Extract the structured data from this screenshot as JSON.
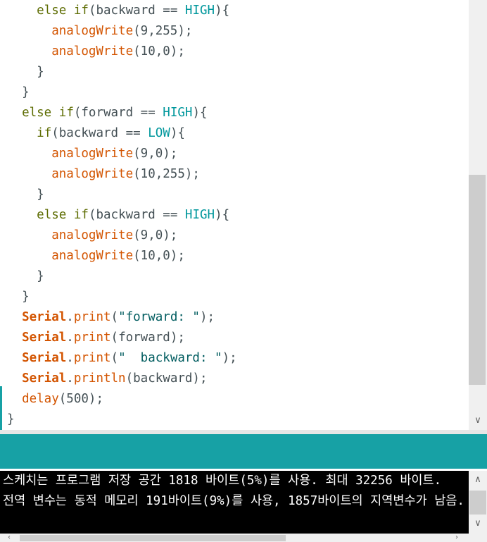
{
  "editor": {
    "lines": [
      {
        "indent": "    ",
        "tokens": [
          {
            "t": "else",
            "c": "kw"
          },
          {
            "t": " ",
            "c": "pn"
          },
          {
            "t": "if",
            "c": "kw"
          },
          {
            "t": "(backward == ",
            "c": "pn"
          },
          {
            "t": "HIGH",
            "c": "cst"
          },
          {
            "t": "){",
            "c": "pn"
          }
        ]
      },
      {
        "indent": "      ",
        "tokens": [
          {
            "t": "analogWrite",
            "c": "fn"
          },
          {
            "t": "(9,255);",
            "c": "pn"
          }
        ]
      },
      {
        "indent": "      ",
        "tokens": [
          {
            "t": "analogWrite",
            "c": "fn"
          },
          {
            "t": "(10,0);",
            "c": "pn"
          }
        ]
      },
      {
        "indent": "    ",
        "tokens": [
          {
            "t": "}",
            "c": "pn"
          }
        ]
      },
      {
        "indent": "  ",
        "tokens": [
          {
            "t": "}",
            "c": "pn"
          }
        ]
      },
      {
        "indent": "  ",
        "tokens": [
          {
            "t": "else",
            "c": "kw"
          },
          {
            "t": " ",
            "c": "pn"
          },
          {
            "t": "if",
            "c": "kw"
          },
          {
            "t": "(forward == ",
            "c": "pn"
          },
          {
            "t": "HIGH",
            "c": "cst"
          },
          {
            "t": "){",
            "c": "pn"
          }
        ]
      },
      {
        "indent": "    ",
        "tokens": [
          {
            "t": "if",
            "c": "kw"
          },
          {
            "t": "(backward == ",
            "c": "pn"
          },
          {
            "t": "LOW",
            "c": "cst"
          },
          {
            "t": "){",
            "c": "pn"
          }
        ]
      },
      {
        "indent": "      ",
        "tokens": [
          {
            "t": "analogWrite",
            "c": "fn"
          },
          {
            "t": "(9,0);",
            "c": "pn"
          }
        ]
      },
      {
        "indent": "      ",
        "tokens": [
          {
            "t": "analogWrite",
            "c": "fn"
          },
          {
            "t": "(10,255);",
            "c": "pn"
          }
        ]
      },
      {
        "indent": "    ",
        "tokens": [
          {
            "t": "}",
            "c": "pn"
          }
        ]
      },
      {
        "indent": "    ",
        "tokens": [
          {
            "t": "else",
            "c": "kw"
          },
          {
            "t": " ",
            "c": "pn"
          },
          {
            "t": "if",
            "c": "kw"
          },
          {
            "t": "(backward == ",
            "c": "pn"
          },
          {
            "t": "HIGH",
            "c": "cst"
          },
          {
            "t": "){",
            "c": "pn"
          }
        ]
      },
      {
        "indent": "      ",
        "tokens": [
          {
            "t": "analogWrite",
            "c": "fn"
          },
          {
            "t": "(9,0);",
            "c": "pn"
          }
        ]
      },
      {
        "indent": "      ",
        "tokens": [
          {
            "t": "analogWrite",
            "c": "fn"
          },
          {
            "t": "(10,0);",
            "c": "pn"
          }
        ]
      },
      {
        "indent": "    ",
        "tokens": [
          {
            "t": "}",
            "c": "pn"
          }
        ]
      },
      {
        "indent": "  ",
        "tokens": [
          {
            "t": "}",
            "c": "pn"
          }
        ]
      },
      {
        "indent": "  ",
        "tokens": [
          {
            "t": "Serial",
            "c": "obj"
          },
          {
            "t": ".",
            "c": "pn"
          },
          {
            "t": "print",
            "c": "fn"
          },
          {
            "t": "(",
            "c": "pn"
          },
          {
            "t": "\"forward: \"",
            "c": "str"
          },
          {
            "t": ");",
            "c": "pn"
          }
        ]
      },
      {
        "indent": "  ",
        "tokens": [
          {
            "t": "Serial",
            "c": "obj"
          },
          {
            "t": ".",
            "c": "pn"
          },
          {
            "t": "print",
            "c": "fn"
          },
          {
            "t": "(forward);",
            "c": "pn"
          }
        ]
      },
      {
        "indent": "  ",
        "tokens": [
          {
            "t": "Serial",
            "c": "obj"
          },
          {
            "t": ".",
            "c": "pn"
          },
          {
            "t": "print",
            "c": "fn"
          },
          {
            "t": "(",
            "c": "pn"
          },
          {
            "t": "\"  backward: \"",
            "c": "str"
          },
          {
            "t": ");",
            "c": "pn"
          }
        ]
      },
      {
        "indent": "  ",
        "tokens": [
          {
            "t": "Serial",
            "c": "obj"
          },
          {
            "t": ".",
            "c": "pn"
          },
          {
            "t": "println",
            "c": "fn"
          },
          {
            "t": "(backward);",
            "c": "pn"
          }
        ]
      },
      {
        "indent": "  ",
        "tokens": [
          {
            "t": "delay",
            "c": "fn"
          },
          {
            "t": "(500);",
            "c": "pn"
          }
        ]
      },
      {
        "indent": "",
        "tokens": [
          {
            "t": "}",
            "c": "pn"
          }
        ]
      }
    ]
  },
  "console": {
    "lines": [
      "스케치는 프로그램 저장 공간 1818 바이트(5%)를 사용. 최대 32256 바이트.",
      "전역 변수는 동적 메모리 191바이트(9%)를 사용, 1857바이트의 지역변수가 남음."
    ]
  },
  "icons": {
    "scroll_down": "chevron-down-icon",
    "scroll_up": "chevron-up-icon",
    "scroll_left": "chevron-left-icon",
    "scroll_right": "chevron-right-icon"
  },
  "colors": {
    "status_bar": "#17a1a5",
    "keyword": "#5e6d03",
    "function": "#d35400",
    "constant": "#00979c",
    "string": "#005c5f",
    "console_bg": "#000000"
  }
}
